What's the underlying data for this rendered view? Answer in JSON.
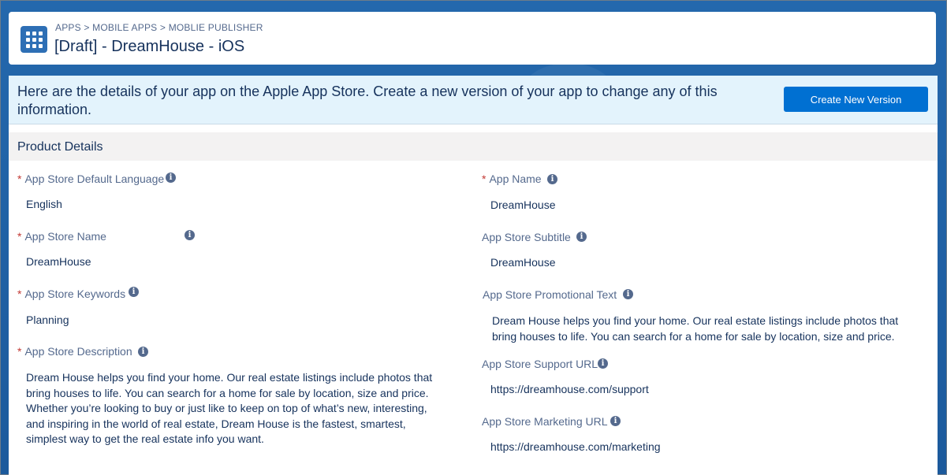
{
  "header": {
    "breadcrumbs": [
      "APPS",
      "MOBILE APPS",
      "MOBLIE PUBLISHER"
    ],
    "breadcrumb_sep": ">",
    "title": "[Draft] - DreamHouse - iOS"
  },
  "banner": {
    "text": "Here are the details of your app on the Apple App Store. Create a new version of your app to change any of this information.",
    "button_label": "Create New Version"
  },
  "section": {
    "title": "Product Details"
  },
  "fields": {
    "default_language": {
      "label": "App Store Default Language",
      "required": true,
      "value": "English"
    },
    "store_name": {
      "label": "App Store Name",
      "required": true,
      "value": "DreamHouse"
    },
    "keywords": {
      "label": "App Store Keywords",
      "required": true,
      "value": "Planning"
    },
    "description": {
      "label": "App Store Description",
      "required": true,
      "value": "Dream House helps you find your home. Our real estate listings include photos that bring houses to life. You can search for a home for sale by location, size and price. Whether you’re looking to buy or just like to keep on top of what’s new, interesting, and inspiring in the world of real estate, Dream House is the fastest, smartest, simplest way to get the real estate info you want."
    },
    "app_name": {
      "label": "App Name",
      "required": true,
      "value": "DreamHouse"
    },
    "subtitle": {
      "label": "App Store Subtitle",
      "required": false,
      "value": "DreamHouse"
    },
    "promo_text": {
      "label": "App Store Promotional Text",
      "required": false,
      "value": "Dream House helps you find your home. Our real estate listings include photos that bring houses to life. You can search for a home for sale by location, size and price."
    },
    "support_url": {
      "label": "App Store Support URL",
      "required": false,
      "value": "https://dreamhouse.com/support"
    },
    "marketing_url": {
      "label": "App Store Marketing URL",
      "required": false,
      "value": "https://dreamhouse.com/marketing"
    }
  },
  "ui": {
    "required_marker": "*",
    "info_glyph": "i"
  },
  "colors": {
    "accent": "#0070d2",
    "header_icon": "#2e6fb5",
    "banner_bg": "#e3f3fc",
    "required": "#c23934"
  }
}
